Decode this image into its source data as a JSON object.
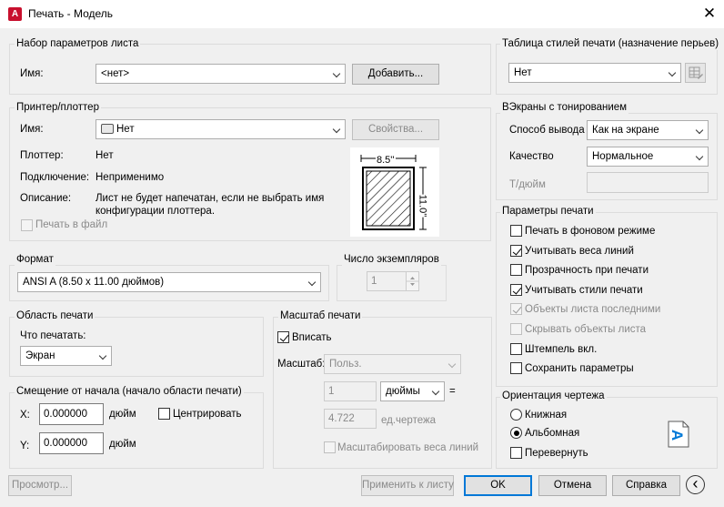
{
  "window": {
    "title": "Печать - Модель",
    "app_icon_letter": "A",
    "close_glyph": "✕"
  },
  "page_setup": {
    "group_title": "Набор параметров листа",
    "name_label": "Имя:",
    "name_value": "<нет>",
    "add_button": "Добавить..."
  },
  "printer": {
    "group_title": "Принтер/плоттер",
    "name_label": "Имя:",
    "name_value": "Нет",
    "properties_button": "Свойства...",
    "plotter_label": "Плоттер:",
    "plotter_value": "Нет",
    "connection_label": "Подключение:",
    "connection_value": "Неприменимо",
    "description_label": "Описание:",
    "description_line1": "Лист не будет напечатан, если не выбрать имя",
    "description_line2": "конфигурации плоттера.",
    "print_to_file": "Печать в файл",
    "preview_width": "8.5''",
    "preview_height": "11.0''"
  },
  "format": {
    "group_title": "Формат",
    "value": "ANSI A (8.50 x 11.00 дюймов)"
  },
  "copies": {
    "group_title": "Число экземпляров",
    "value": "1"
  },
  "plot_area": {
    "group_title": "Область печати",
    "what_label": "Что печатать:",
    "what_value": "Экран"
  },
  "offset": {
    "group_title": "Смещение от начала (начало области печати)",
    "x_label": "X:",
    "x_value": "0.000000",
    "x_unit": "дюйм",
    "y_label": "Y:",
    "y_value": "0.000000",
    "y_unit": "дюйм",
    "center_label": "Центрировать"
  },
  "scale": {
    "group_title": "Масштаб печати",
    "fit_label": "Вписать",
    "scale_label": "Масштаб:",
    "scale_value": "Польз.",
    "num_value": "1",
    "unit_value": "дюймы",
    "equals": "=",
    "den_value": "4.722",
    "den_unit": "ед.чертежа",
    "scale_lineweights": "Масштабировать веса линий"
  },
  "style_table": {
    "group_title": "Таблица стилей печати (назначение перьев)",
    "value": "Нет"
  },
  "shaded": {
    "group_title": "ВЭкраны с тонированием",
    "output_label": "Способ вывода",
    "output_value": "Как на экране",
    "quality_label": "Качество",
    "quality_value": "Нормальное",
    "dpi_label": "Т/дюйм"
  },
  "plot_options": {
    "group_title": "Параметры печати",
    "items": [
      {
        "label": "Печать в фоновом режиме",
        "checked": false,
        "disabled": false
      },
      {
        "label": "Учитывать веса линий",
        "checked": true,
        "disabled": false
      },
      {
        "label": "Прозрачность при печати",
        "checked": false,
        "disabled": false
      },
      {
        "label": "Учитывать стили печати",
        "checked": true,
        "disabled": false
      },
      {
        "label": "Объекты листа последними",
        "checked": true,
        "disabled": true
      },
      {
        "label": "Скрывать объекты листа",
        "checked": false,
        "disabled": true
      },
      {
        "label": "Штемпель вкл.",
        "checked": false,
        "disabled": false
      },
      {
        "label": "Сохранить параметры",
        "checked": false,
        "disabled": false
      }
    ]
  },
  "orientation": {
    "group_title": "Ориентация чертежа",
    "portrait": "Книжная",
    "landscape": "Альбомная",
    "upside_down": "Перевернуть",
    "selected": "landscape",
    "icon_letter": "A"
  },
  "footer": {
    "preview": "Просмотр...",
    "apply": "Применить к листу",
    "ok": "OK",
    "cancel": "Отмена",
    "help": "Справка",
    "collapse_glyph": "‹"
  },
  "colors": {
    "accent": "#0078d7",
    "autocad_red": "#c8102e",
    "disabled_text": "#8a8a8a"
  }
}
